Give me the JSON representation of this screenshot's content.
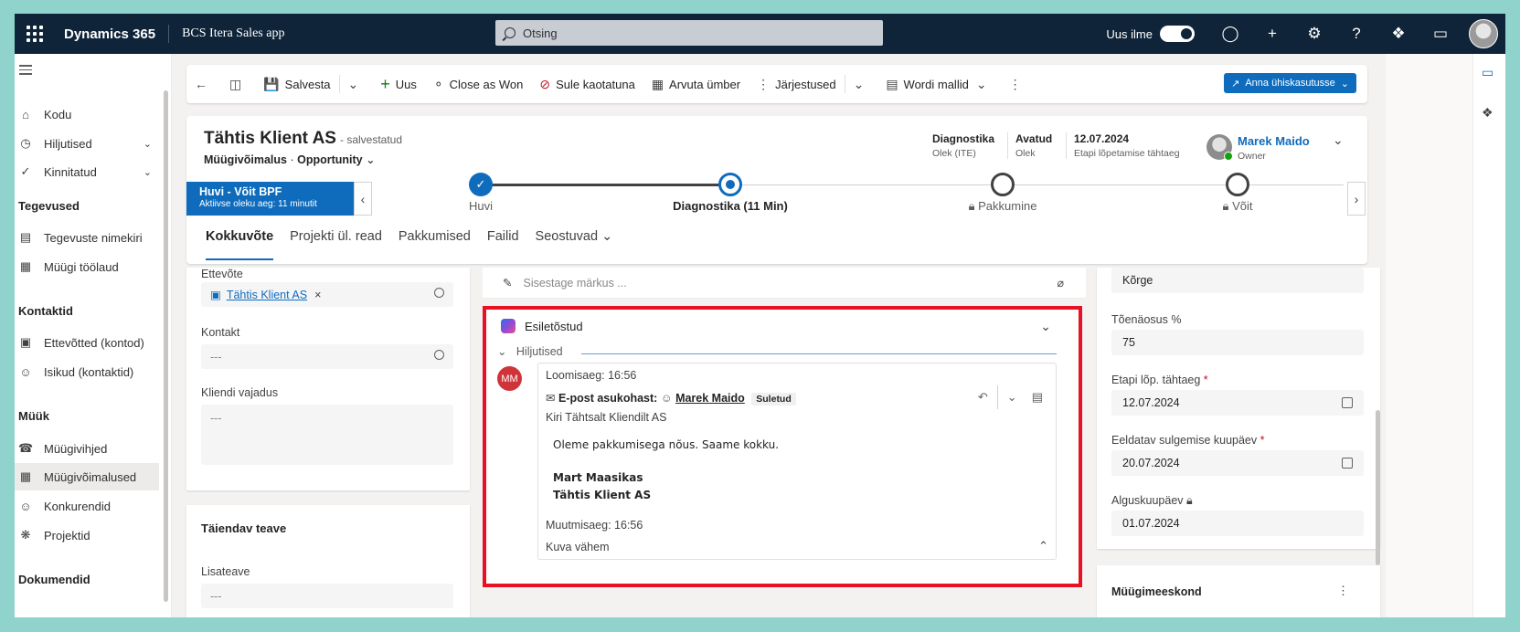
{
  "topbar": {
    "brand": "Dynamics 365",
    "app_name": "BCS Itera Sales app",
    "search_placeholder": "Otsing",
    "new_look_label": "Uus ilme"
  },
  "leftnav": {
    "items": [
      {
        "label": "Kodu",
        "icon": "home-icon"
      },
      {
        "label": "Hiljutised",
        "icon": "clock-icon"
      },
      {
        "label": "Kinnitatud",
        "icon": "pin-icon"
      }
    ],
    "sections": [
      {
        "title": "Tegevused",
        "items": [
          {
            "label": "Tegevuste nimekiri",
            "icon": "clipboard-icon"
          },
          {
            "label": "Müügi töölaud",
            "icon": "dashboard-icon"
          }
        ]
      },
      {
        "title": "Kontaktid",
        "items": [
          {
            "label": "Ettevõtted (kontod)",
            "icon": "building-icon"
          },
          {
            "label": "Isikud (kontaktid)",
            "icon": "person-icon"
          }
        ]
      },
      {
        "title": "Müük",
        "items": [
          {
            "label": "Müügivihjed",
            "icon": "phone-person-icon"
          },
          {
            "label": "Müügivõimalused",
            "icon": "opportunity-icon"
          },
          {
            "label": "Konkurendid",
            "icon": "person-icon"
          },
          {
            "label": "Projektid",
            "icon": "puzzle-icon"
          }
        ]
      },
      {
        "title": "Dokumendid",
        "items": []
      }
    ]
  },
  "commandbar": {
    "save": "Salvesta",
    "new": "Uus",
    "close_won": "Close as Won",
    "close_lost": "Sule kaotatuna",
    "recalculate": "Arvuta ümber",
    "sequences": "Järjestused",
    "word_templates": "Wordi mallid",
    "share": "Anna ühiskasutusse"
  },
  "record": {
    "title": "Tähtis Klient AS",
    "saved_status": "- salvestatud",
    "entity": "Müügivõimalus",
    "form": "Opportunity",
    "header_fields": [
      {
        "value": "Diagnostika",
        "label": "Olek (ITE)"
      },
      {
        "value": "Avatud",
        "label": "Olek"
      },
      {
        "value": "12.07.2024",
        "label": "Etapi lõpetamise tähtaeg"
      }
    ],
    "owner_name": "Marek Maido",
    "owner_label": "Owner"
  },
  "bpf": {
    "title": "Huvi - Võit BPF",
    "subtitle": "Aktiivse oleku aeg: 11 minutit",
    "stages": [
      {
        "label": "Huvi",
        "state": "completed"
      },
      {
        "label": "Diagnostika  (11 Min)",
        "state": "active"
      },
      {
        "label": "Pakkumine",
        "state": "locked"
      },
      {
        "label": "Võit",
        "state": "locked"
      }
    ]
  },
  "tabs": [
    "Kokkuvõte",
    "Projekti ül. read",
    "Pakkumised",
    "Failid",
    "Seostuvad"
  ],
  "left_form": {
    "company_label": "Ettevõte",
    "company_value": "Tähtis Klient AS",
    "contact_label": "Kontakt",
    "contact_value": "---",
    "need_label": "Kliendi vajadus",
    "need_value": "---",
    "extra_title": "Täiendav teave",
    "extra_label": "Lisateave",
    "extra_value": "---"
  },
  "timeline": {
    "note_placeholder": "Sisestage märkus ...",
    "highlights": "Esiletõstud",
    "recent": "Hiljutised",
    "avatar_initials": "MM",
    "created": "Loomisaeg: 16:56",
    "email_from_label": "E-post asukohast:",
    "email_from_name": "Marek Maido",
    "email_status": "Suletud",
    "subject": "Kiri Tähtsalt Kliendilt AS",
    "body_line1": "Oleme pakkumisega nõus. Saame kokku.",
    "sig_name": "Mart Maasikas",
    "sig_company": "Tähtis Klient AS",
    "modified": "Muutmisaeg: 16:56",
    "show_less": "Kuva vähem"
  },
  "right_form": {
    "rating_value": "Kõrge",
    "probability_label": "Tõenäosus %",
    "probability_value": "75",
    "stage_due_label": "Etapi lõp. tähtaeg",
    "stage_due_value": "12.07.2024",
    "close_date_label": "Eeldatav sulgemise kuupäev",
    "close_date_value": "20.07.2024",
    "start_date_label": "Alguskuupäev",
    "start_date_value": "01.07.2024",
    "sales_team_label": "Müügimeeskond",
    "required_mark": "*"
  },
  "colors": {
    "accent": "#0f6cbd",
    "topbar": "#0f2439",
    "highlight_border": "#e81123"
  }
}
